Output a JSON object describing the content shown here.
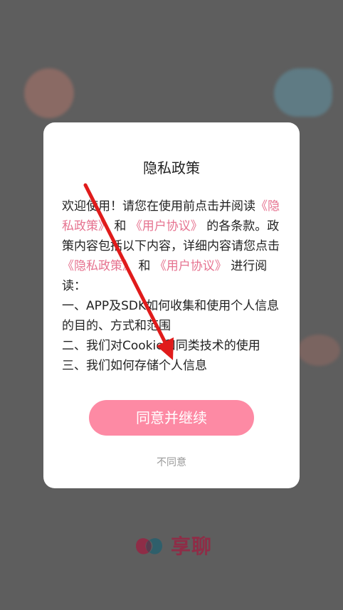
{
  "dialog": {
    "title": "隐私政策",
    "intro_1": "欢迎使用！请您在使用前点击并阅读",
    "link_privacy_1": "《隐私政策》",
    "and_1": "和",
    "link_user_1": "《用户协议》",
    "intro_2": "的各条款。政策内容包括以下内容，详细内容请您点击",
    "link_privacy_2": "《隐私政策》",
    "and_2": "和",
    "link_user_2": "《用户协议》",
    "intro_3": "进行阅读：",
    "item_1": "一、APP及SDK如何收集和使用个人信息的目的、方式和范围",
    "item_2": "二、我们对Cookie和同类技术的使用",
    "item_3": "三、我们如何存储个人信息",
    "agree_button": "同意并继续",
    "disagree_link": "不同意"
  },
  "brand": {
    "name": "享聊",
    "logo_icon": "xiangliao-logo-icon"
  },
  "colors": {
    "accent_pink": "#fd8aa4",
    "link_pink": "#e6728f",
    "annotation_red": "#e01b1b",
    "overlay": "#5e5e5e"
  }
}
